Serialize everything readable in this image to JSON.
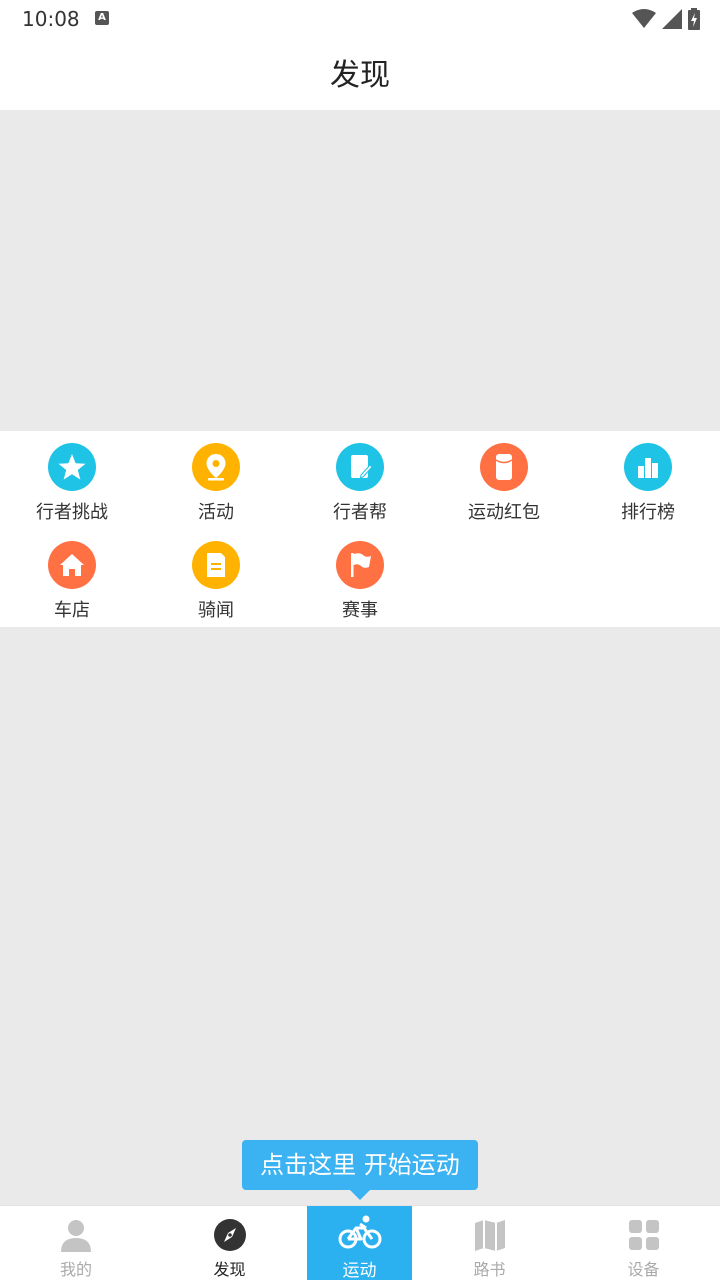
{
  "status": {
    "time": "10:08",
    "badge": "A"
  },
  "header": {
    "title": "发现"
  },
  "grid": [
    {
      "label": "行者挑战",
      "icon": "star-icon",
      "color": "#1fc3e6"
    },
    {
      "label": "活动",
      "icon": "location-pin-icon",
      "color": "#ffb300"
    },
    {
      "label": "行者帮",
      "icon": "note-edit-icon",
      "color": "#1fc3e6"
    },
    {
      "label": "运动红包",
      "icon": "red-packet-icon",
      "color": "#ff7043"
    },
    {
      "label": "排行榜",
      "icon": "podium-icon",
      "color": "#1fc3e6"
    },
    {
      "label": "车店",
      "icon": "house-icon",
      "color": "#ff7043"
    },
    {
      "label": "骑闻",
      "icon": "document-icon",
      "color": "#ffb300"
    },
    {
      "label": "赛事",
      "icon": "flag-icon",
      "color": "#ff7043"
    }
  ],
  "tooltip": {
    "text": "点击这里 开始运动"
  },
  "tabs": [
    {
      "label": "我的",
      "icon": "person-icon"
    },
    {
      "label": "发现",
      "icon": "compass-icon"
    },
    {
      "label": "运动",
      "icon": "bicycle-icon"
    },
    {
      "label": "路书",
      "icon": "map-icon"
    },
    {
      "label": "设备",
      "icon": "grid-icon"
    }
  ],
  "colors": {
    "accent": "#2bb0f0",
    "background": "#eaeaea"
  }
}
